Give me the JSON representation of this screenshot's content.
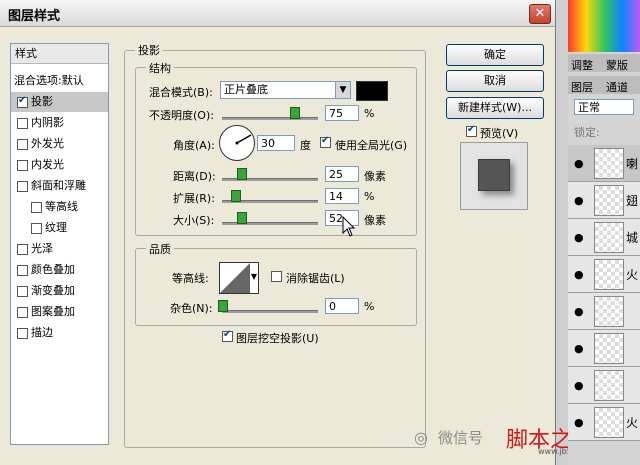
{
  "dialog": {
    "title": "图层样式",
    "close_glyph": "✕"
  },
  "sidebar": {
    "header": "样式",
    "blend": "混合选项:默认",
    "items": [
      {
        "label": "投影",
        "checked": true
      },
      {
        "label": "内阴影",
        "checked": false
      },
      {
        "label": "外发光",
        "checked": false
      },
      {
        "label": "内发光",
        "checked": false
      },
      {
        "label": "斜面和浮雕",
        "checked": false
      },
      {
        "label": "等高线",
        "checked": false
      },
      {
        "label": "纹理",
        "checked": false
      },
      {
        "label": "光泽",
        "checked": false
      },
      {
        "label": "颜色叠加",
        "checked": false
      },
      {
        "label": "渐变叠加",
        "checked": false
      },
      {
        "label": "图案叠加",
        "checked": false
      },
      {
        "label": "描边",
        "checked": false
      }
    ]
  },
  "section": {
    "title": "投影",
    "structure_title": "结构",
    "blend_mode_label": "混合模式(B):",
    "blend_mode_value": "正片叠底",
    "opacity_label": "不透明度(O):",
    "opacity_value": "75",
    "opacity_unit": "%",
    "angle_label": "角度(A):",
    "angle_value": "30",
    "angle_unit": "度",
    "global_light_label": "使用全局光(G)",
    "distance_label": "距离(D):",
    "distance_value": "25",
    "distance_unit": "像素",
    "spread_label": "扩展(R):",
    "spread_value": "14",
    "spread_unit": "%",
    "size_label": "大小(S):",
    "size_value": "52",
    "size_unit": "像素",
    "quality_title": "品质",
    "contour_label": "等高线:",
    "antialias_label": "消除锯齿(L)",
    "noise_label": "杂色(N):",
    "noise_value": "0",
    "noise_unit": "%",
    "knockout_label": "图层挖空投影(U)"
  },
  "slider_levels": {
    "opacity": 0.75,
    "distance": 0.2,
    "spread": 0.14,
    "size": 0.2,
    "noise": 0.0
  },
  "buttons": {
    "ok": "确定",
    "cancel": "取消",
    "new_style": "新建样式(W)...",
    "preview": "预览(V)"
  },
  "right_panel": {
    "tab_adjust": "调整",
    "tab_mask": "蒙版",
    "tab_layers": "图层",
    "tab_channels": "通道",
    "blend_mode": "正常",
    "lock_label": "锁定:",
    "layers": [
      "喇",
      "翅",
      "城",
      "火",
      "",
      "",
      "",
      "火"
    ]
  },
  "watermark": {
    "wechat": "微信号",
    "site_name": "脚本之家",
    "site_url": "www.jb51.net"
  },
  "colors": {
    "shadow_swatch": "#000000",
    "accent_blue": "#0b3f8b"
  }
}
